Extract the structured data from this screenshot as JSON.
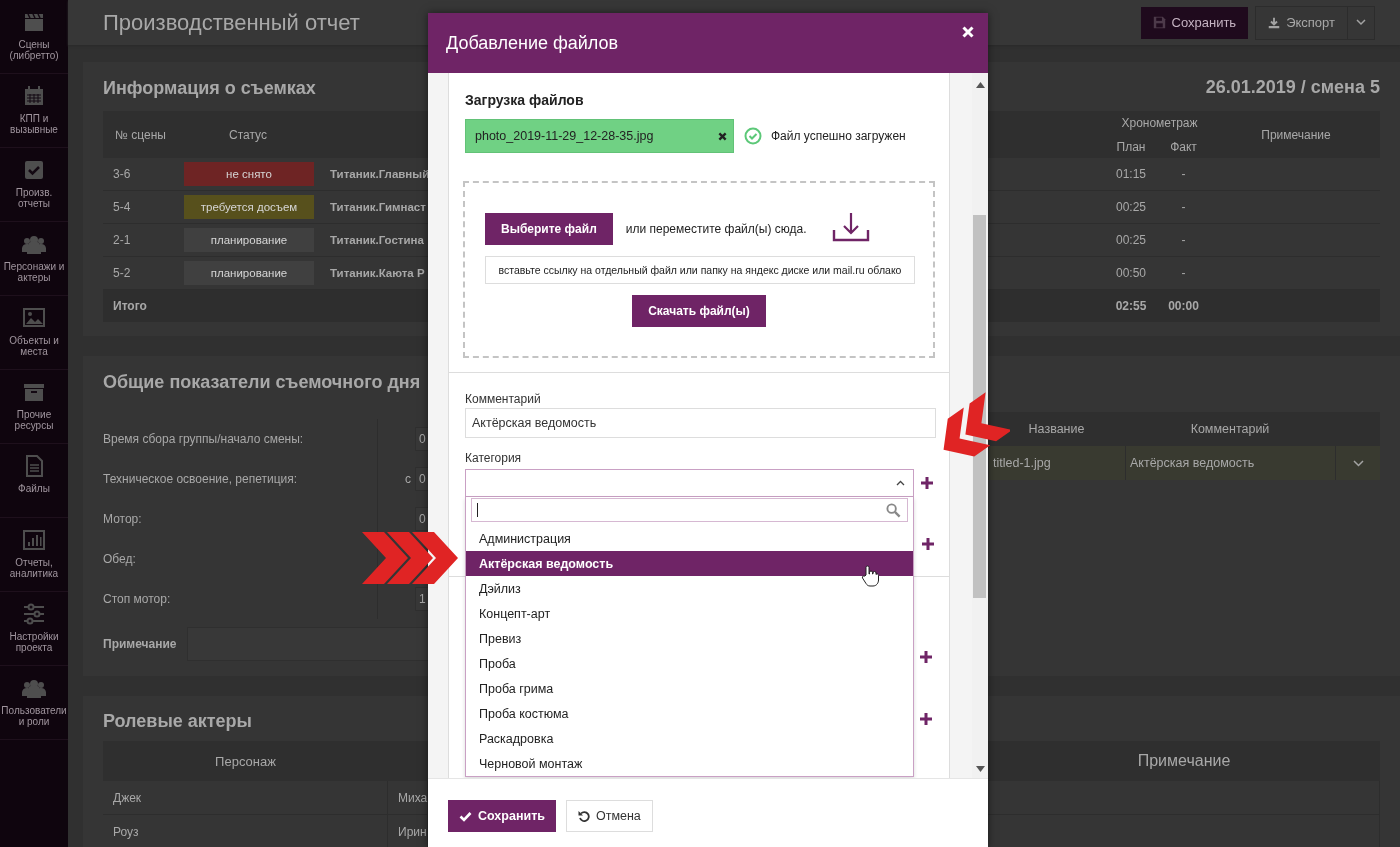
{
  "sidebar": {
    "items": [
      {
        "label": "Сцены (либретто)"
      },
      {
        "label": "КПП и вызывные"
      },
      {
        "label": "Произв. отчеты"
      },
      {
        "label": "Персонажи и актеры"
      },
      {
        "label": "Объекты и места"
      },
      {
        "label": "Прочие ресурсы"
      },
      {
        "label": "Файлы"
      },
      {
        "label": "Отчеты, аналитика"
      },
      {
        "label": "Настройки проекта"
      },
      {
        "label": "Пользователи и роли"
      }
    ]
  },
  "header": {
    "title": "Производственный отчет",
    "buttons": [
      {
        "label": "Сохранить",
        "kind": "primary"
      },
      {
        "label": "Экспорт",
        "kind": "split"
      }
    ]
  },
  "shooting_info": {
    "title": "Информация о съемках",
    "date": "26.01.2019 / смена 5",
    "columns": {
      "scene": "№ сцены",
      "status": "Статус",
      "timing": "Хронометраж",
      "plan": "План",
      "fact": "Факт",
      "note": "Примечание"
    },
    "rows": [
      {
        "scene": "3-6",
        "status": "не снято",
        "color": "#6e2424",
        "title": "Титаник.Главный",
        "plan": "01:15",
        "fact": "-"
      },
      {
        "scene": "5-4",
        "status": "требуется досъем",
        "color": "#57501c",
        "title": "Титаник.Гимнаст",
        "plan": "00:25",
        "fact": "-"
      },
      {
        "scene": "2-1",
        "status": "планирование",
        "color": "#404040",
        "title": "Титаник.Гостина",
        "plan": "00:25",
        "fact": "-"
      },
      {
        "scene": "5-2",
        "status": "планирование",
        "color": "#404040",
        "title": "Титаник.Каюта Р",
        "plan": "00:50",
        "fact": "-"
      }
    ],
    "total": {
      "label": "Итого",
      "plan": "02:55",
      "fact": "00:00"
    }
  },
  "day_metrics": {
    "title": "Общие показатели съемочного дня",
    "rows": [
      {
        "label": "Время сбора группы/начало смены:",
        "value": "0"
      },
      {
        "label": "Техническое освоение, репетиция:",
        "prefix": "с",
        "value": "0"
      },
      {
        "label": "Мотор:",
        "value": "0"
      },
      {
        "label": "Обед:"
      },
      {
        "label": "Стоп мотор:",
        "value": "1"
      }
    ],
    "note_label": "Примечание"
  },
  "files": {
    "columns": [
      "Название",
      "Комментарий"
    ],
    "rows": [
      {
        "name": "titled-1.jpg",
        "comment": "Актёрская ведомость"
      }
    ]
  },
  "actors": {
    "title": "Ролевые актеры",
    "columns": [
      "Персонаж",
      "Примечание"
    ],
    "rows": [
      {
        "character": "Джек",
        "actor": "Миха"
      },
      {
        "character": "Роуз",
        "actor": "Ирин"
      }
    ]
  },
  "modal": {
    "title": "Добавление файлов",
    "upload_title": "Загрузка файлов",
    "file": {
      "name": "photo_2019-11-29_12-28-35.jpg",
      "status": "Файл успешно загружен"
    },
    "choose_button": "Выберите файл",
    "drop_hint": "или переместите файл(ы) сюда.",
    "link_placeholder": "вставьте ссылку на отдельный файл или папку на яндекс диске или mail.ru облако",
    "download_button": "Скачать файл(ы)",
    "comment": {
      "label": "Комментарий",
      "value": "Актёрская ведомость"
    },
    "category": {
      "label": "Категория",
      "expanded": true,
      "options": [
        {
          "label": "Администрация",
          "selected": false
        },
        {
          "label": "Актёрская ведомость",
          "selected": true
        },
        {
          "label": "Дэйлиз",
          "selected": false
        },
        {
          "label": "Концепт-арт",
          "selected": false
        },
        {
          "label": "Превиз",
          "selected": false
        },
        {
          "label": "Проба",
          "selected": false
        },
        {
          "label": "Проба грима",
          "selected": false
        },
        {
          "label": "Проба костюма",
          "selected": false
        },
        {
          "label": "Раскадровка",
          "selected": false
        },
        {
          "label": "Черновой монтаж",
          "selected": false
        }
      ]
    },
    "footer_buttons": [
      {
        "label": "Сохранить",
        "kind": "primary"
      },
      {
        "label": "Отмена",
        "kind": "secondary"
      }
    ]
  }
}
